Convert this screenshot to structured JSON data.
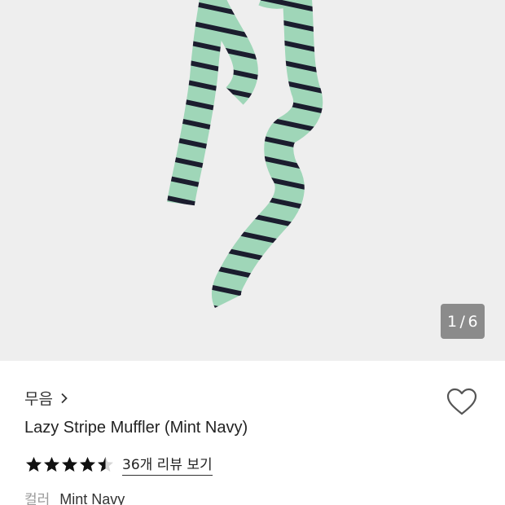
{
  "gallery": {
    "current": "1",
    "separator": "/",
    "total": "6",
    "colors": {
      "background": "#eeeeee",
      "scarf_mint": "#9fd6b8",
      "scarf_stripe": "#1b1d2e",
      "counter_bg": "#8b8b8b"
    }
  },
  "product": {
    "brand": "무음",
    "title": "Lazy Stripe Muffler (Mint Navy)",
    "rating": 4.5,
    "rating_max": 5,
    "review_link": "36개 리뷰 보기",
    "option_label": "컬러",
    "option_value": "Mint Navy"
  },
  "icons": {
    "brand_chevron": "chevron-right-icon",
    "wishlist": "heart-outline-icon",
    "star": "star-icon"
  }
}
